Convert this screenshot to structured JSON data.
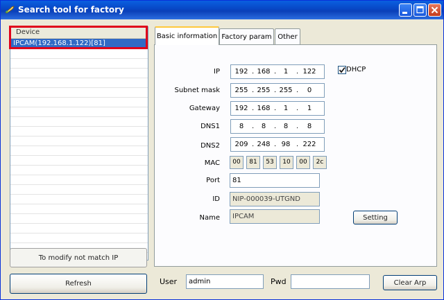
{
  "window": {
    "title": "Search tool for factory",
    "icons": {
      "app": "wrench-icon",
      "minimize": "minimize-icon",
      "maximize": "maximize-icon",
      "close": "close-icon"
    }
  },
  "device_list": {
    "header": "Device",
    "items": [
      "IPCAM(192.168.1.122)[81]"
    ],
    "selected_index": 0
  },
  "buttons": {
    "modify": "To modify not match IP",
    "refresh": "Refresh",
    "setting": "Setting",
    "clear_arp": "Clear Arp"
  },
  "tabs": [
    {
      "label": "Basic information",
      "active": true
    },
    {
      "label": "Factory param",
      "active": false
    },
    {
      "label": "Other",
      "active": false
    }
  ],
  "basic": {
    "ip": {
      "label": "IP",
      "octets": [
        "192",
        "168",
        "1",
        "122"
      ]
    },
    "dhcp": {
      "label": "DHCP",
      "checked": true
    },
    "subnet": {
      "label": "Subnet mask",
      "octets": [
        "255",
        "255",
        "255",
        "0"
      ]
    },
    "gateway": {
      "label": "Gateway",
      "octets": [
        "192",
        "168",
        "1",
        "1"
      ]
    },
    "dns1": {
      "label": "DNS1",
      "octets": [
        "8",
        "8",
        "8",
        "8"
      ]
    },
    "dns2": {
      "label": "DNS2",
      "octets": [
        "209",
        "248",
        "98",
        "222"
      ]
    },
    "mac": {
      "label": "MAC",
      "bytes": [
        "00",
        "81",
        "53",
        "10",
        "00",
        "2c"
      ]
    },
    "port": {
      "label": "Port",
      "value": "81"
    },
    "id": {
      "label": "ID",
      "value": "NIP-000039-UTGND"
    },
    "name": {
      "label": "Name",
      "value": "IPCAM"
    }
  },
  "auth": {
    "user_label": "User",
    "user_value": "admin",
    "pwd_label": "Pwd",
    "pwd_value": ""
  }
}
